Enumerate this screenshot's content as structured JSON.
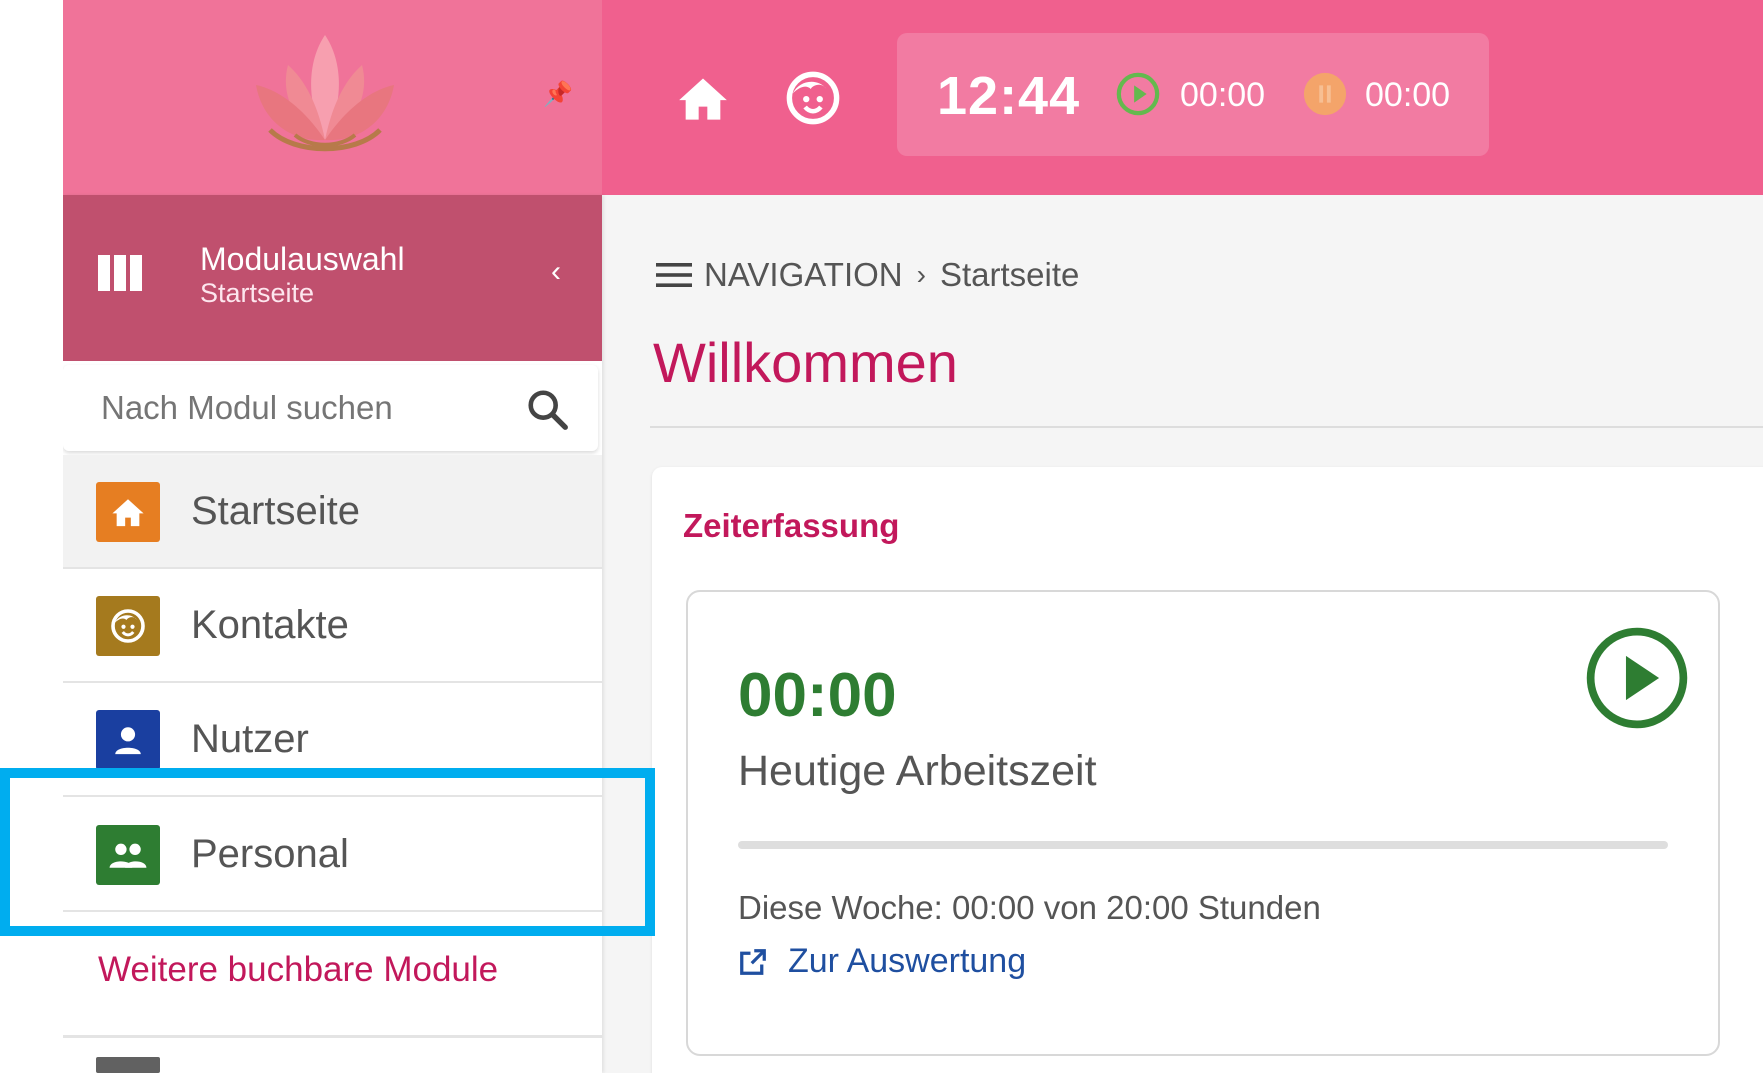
{
  "header": {
    "clock": "12:44",
    "timer_running": "00:00",
    "timer_paused": "00:00",
    "icons": [
      "lotus-logo",
      "pin-icon",
      "home-icon",
      "child-face-icon",
      "play-circle-icon",
      "pause-circle-icon"
    ]
  },
  "sidebar": {
    "module_title": "Modulauswahl",
    "module_subtitle": "Startseite",
    "search_placeholder": "Nach Modul suchen",
    "items": [
      {
        "label": "Startseite",
        "icon": "home-icon",
        "color": "#e67e22"
      },
      {
        "label": "Kontakte",
        "icon": "child-face-icon",
        "color": "#a57a1e"
      },
      {
        "label": "Nutzer",
        "icon": "person-icon",
        "color": "#1a3fa0"
      },
      {
        "label": "Personal",
        "icon": "people-icon",
        "color": "#2e7d32"
      }
    ],
    "more_modules": "Weitere buchbare Module"
  },
  "main": {
    "breadcrumb": {
      "root": "NAVIGATION",
      "current": "Startseite"
    },
    "title": "Willkommen",
    "card": {
      "title": "Zeiterfassung",
      "work_time": "00:00",
      "work_label": "Heutige Arbeitszeit",
      "week_progress": 0,
      "week_summary": "Diese Woche: 00:00 von 20:00 Stunden",
      "evaluation_link": "Zur Auswertung"
    }
  },
  "colors": {
    "primary": "#f0608e",
    "accent": "#c2185b",
    "success": "#2e7d32",
    "highlight": "#00adef"
  }
}
